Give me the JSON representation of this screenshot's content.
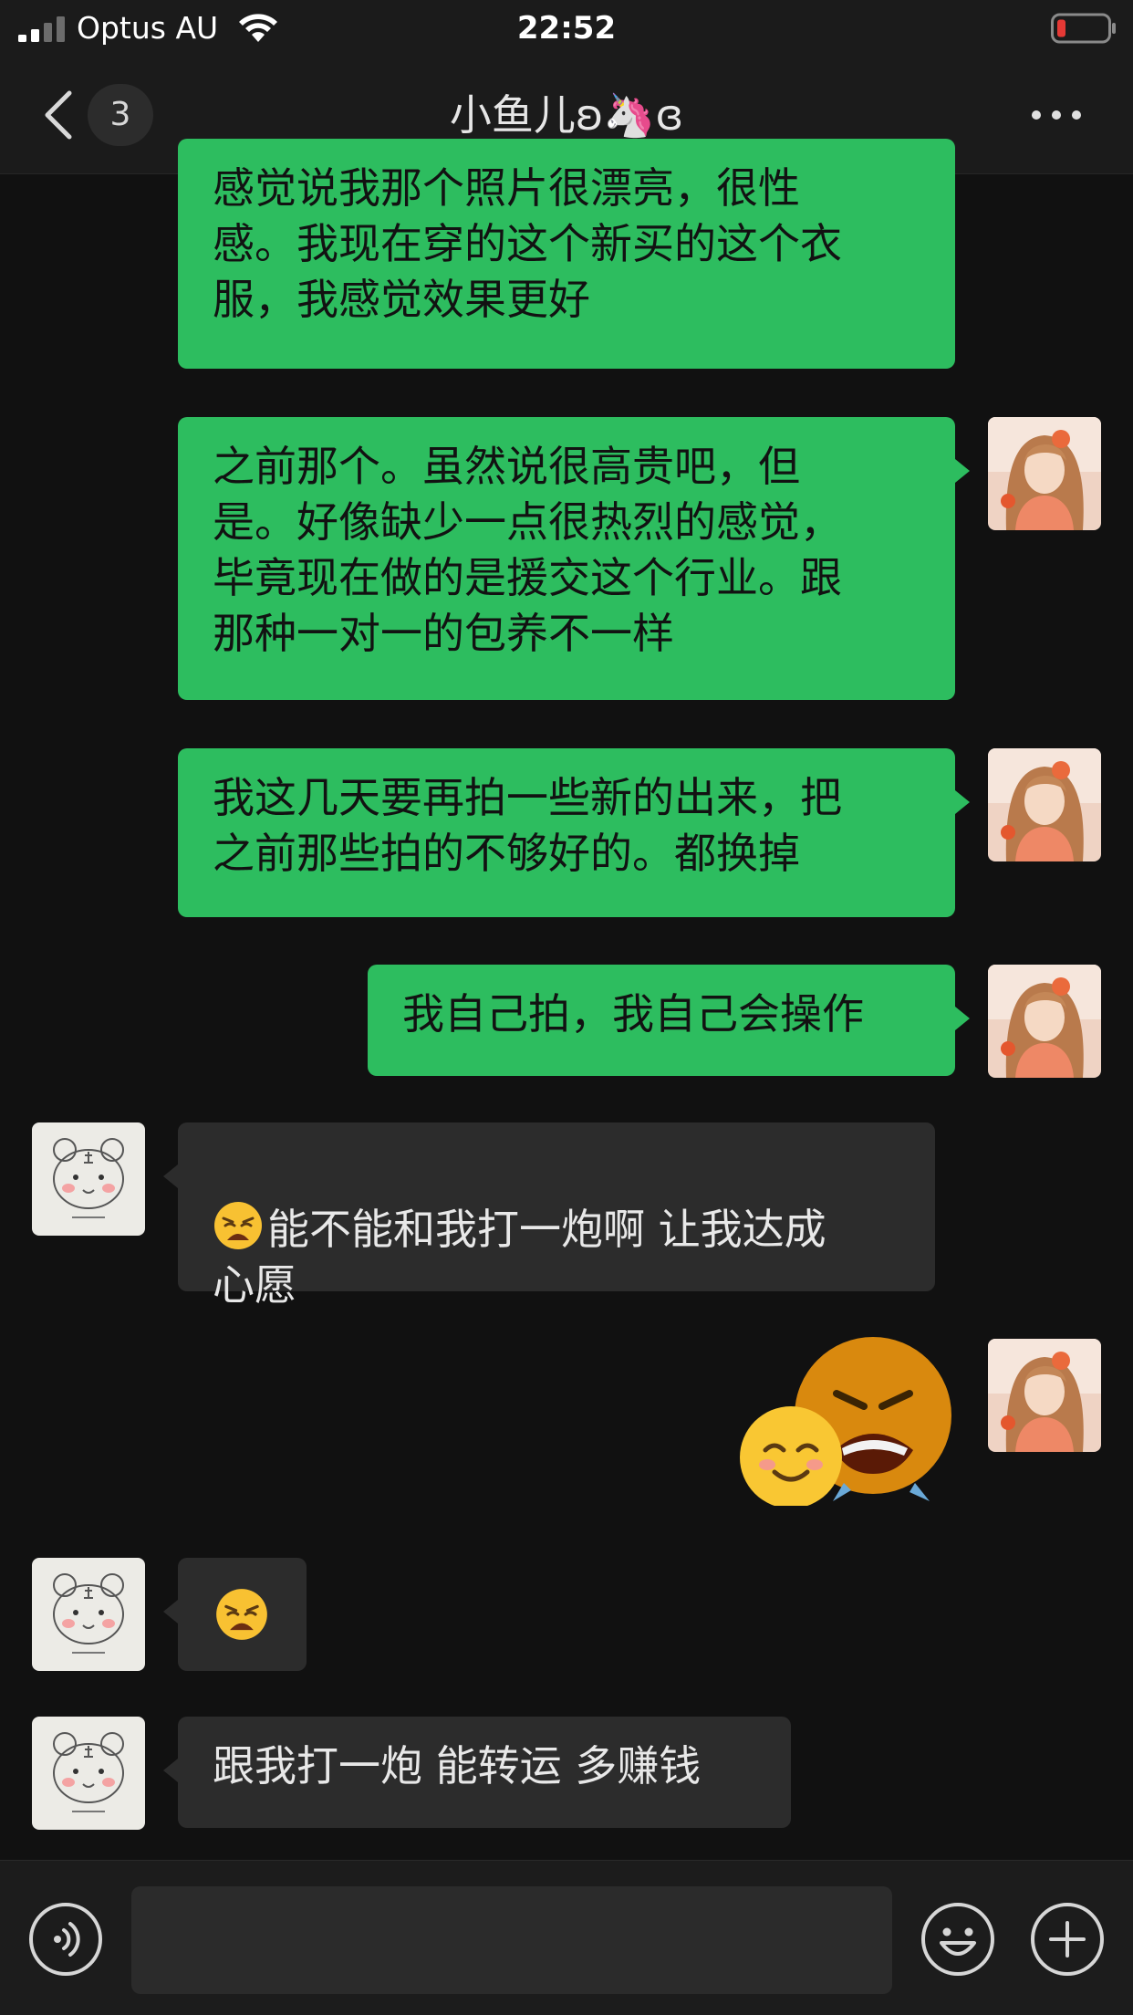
{
  "status_bar": {
    "carrier": "Optus AU",
    "time": "22:52",
    "battery_color": "#e53935"
  },
  "nav": {
    "unread_count": "3",
    "title": "小鱼儿ʚ🦄ɞ"
  },
  "colors": {
    "outgoing_bubble": "#2dbd5f",
    "incoming_bubble": "#2c2c2c",
    "background": "#111111"
  },
  "messages": [
    {
      "direction": "outgoing",
      "type": "text",
      "text": "感觉说我那个照片很漂亮，很性\n感。我现在穿的这个新买的这个衣\n服，我感觉效果更好"
    },
    {
      "direction": "outgoing",
      "type": "text",
      "text": "之前那个。虽然说很高贵吧，但\n是。好像缺少一点很热烈的感觉，\n毕竟现在做的是援交这个行业。跟\n那种一对一的包养不一样"
    },
    {
      "direction": "outgoing",
      "type": "text",
      "text": "我这几天要再拍一些新的出来，把\n之前那些拍的不够好的。都换掉"
    },
    {
      "direction": "outgoing",
      "type": "text",
      "text": "我自己拍，我自己会操作"
    },
    {
      "direction": "incoming",
      "type": "text",
      "emoji_prefix": "weary-face-icon",
      "text": "能不能和我打一炮啊 让我达成\n心愿"
    },
    {
      "direction": "outgoing",
      "type": "sticker",
      "sticker": "angry-and-smiling-emoji-sticker"
    },
    {
      "direction": "incoming",
      "type": "emoji",
      "emoji": "weary-face-icon"
    },
    {
      "direction": "incoming",
      "type": "text",
      "text": "跟我打一炮 能转运 多赚钱"
    }
  ],
  "input": {
    "placeholder": ""
  }
}
